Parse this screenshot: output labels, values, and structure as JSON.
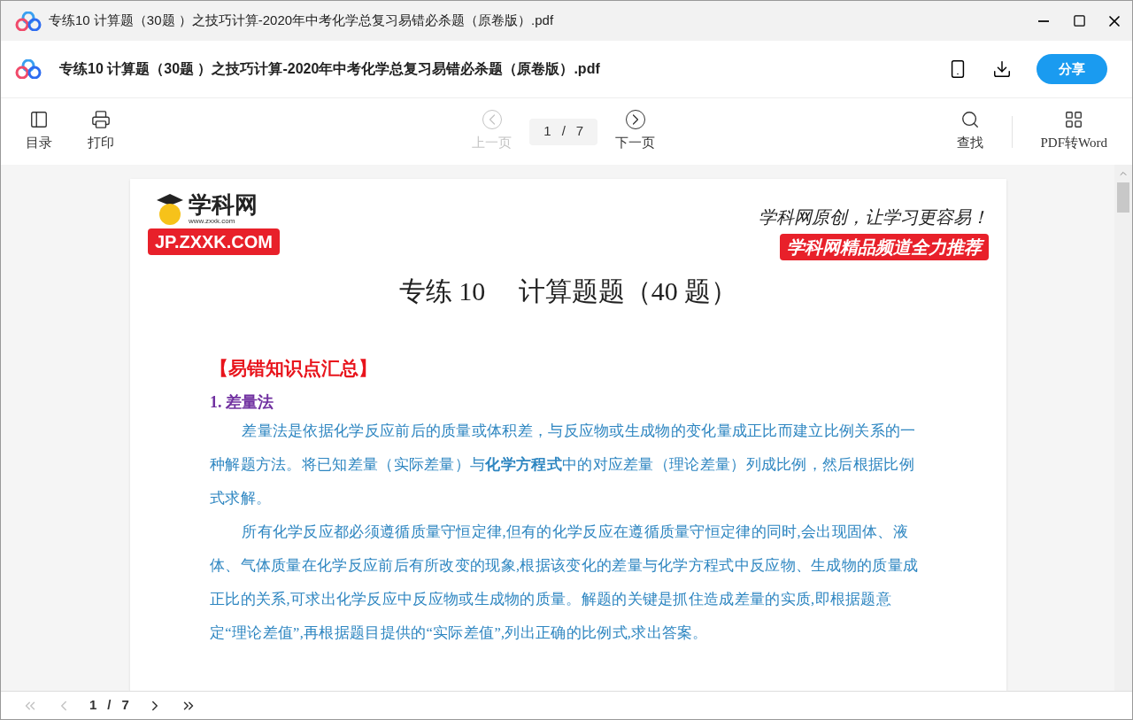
{
  "window": {
    "title": "专练10 计算题（30题 ）之技巧计算-2020年中考化学总复习易错必杀题（原卷版）.pdf"
  },
  "header": {
    "title": "专练10 计算题（30题 ）之技巧计算-2020年中考化学总复习易错必杀题（原卷版）.pdf",
    "share_button": "分享"
  },
  "toolbar": {
    "left": [
      {
        "kind": "outline",
        "label": "目录"
      },
      {
        "kind": "print",
        "label": "打印"
      }
    ],
    "prev": {
      "label": "上一页",
      "disabled": true
    },
    "page_field": {
      "current": "1",
      "separator": "/",
      "total": "7"
    },
    "next": {
      "label": "下一页",
      "disabled": false
    },
    "right": [
      {
        "kind": "search",
        "label": "查找"
      },
      {
        "kind": "convert",
        "label": "PDF转Word"
      }
    ]
  },
  "document": {
    "logo": {
      "name": "学科网",
      "url": "www.zxxk.com",
      "badge": "JP.ZXXK.COM"
    },
    "slogan": "学科网原创，让学习更容易！",
    "banner": "学科网精品频道全力推荐",
    "title": "专练 10　 计算题题（40 题）",
    "section": "【易错知识点汇总】",
    "subsection": "1. 差量法",
    "paragraphs": [
      "差量法是依据化学反应前后的质量或体积差，与反应物或生成物的变化量成正比而建立比例关系的一种解题方法。将已知差量（实际差量）与**化学方程式**中的对应差量（理论差量）列成比例，然后根据比例式求解。",
      "所有化学反应都必须遵循质量守恒定律,但有的化学反应在遵循质量守恒定律的同时,会出现固体、液体、气体质量在化学反应前后有所改变的现象,根据该变化的差量与化学方程式中反应物、生成物的质量成正比的关系,可求出化学反应中反应物或生成物的质量。解题的关键是抓住造成差量的实质,即根据题意定“理论差值”,再根据题目提供的“实际差值”,列出正确的比例式,求出答案。"
    ]
  },
  "pager": {
    "first_disabled": true,
    "prev_disabled": true,
    "current": "1",
    "separator": "/",
    "total": "7",
    "next_disabled": false,
    "last_disabled": false
  }
}
